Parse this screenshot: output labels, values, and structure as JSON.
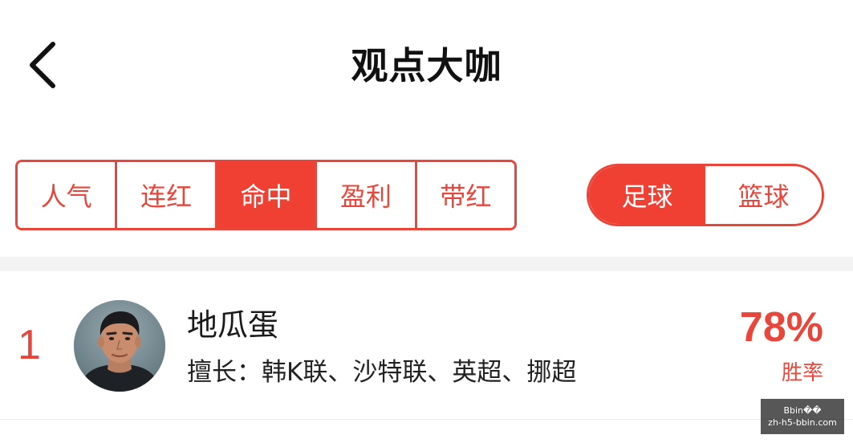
{
  "header": {
    "title": "观点大咖",
    "back_icon": "chevron-left-icon"
  },
  "rank_tabs": [
    {
      "label": "人气",
      "active": false
    },
    {
      "label": "连红",
      "active": false
    },
    {
      "label": "命中",
      "active": true
    },
    {
      "label": "盈利",
      "active": false
    },
    {
      "label": "带红",
      "active": false
    }
  ],
  "sport_toggle": [
    {
      "label": "足球",
      "active": true
    },
    {
      "label": "篮球",
      "active": false
    }
  ],
  "experts": [
    {
      "rank": "1",
      "name": "地瓜蛋",
      "specialty": "擅长：韩K联、沙特联、英超、挪超",
      "win_rate": "78%",
      "win_rate_label": "胜率"
    }
  ],
  "watermark": {
    "line1": "Bbin��",
    "line2": "zh-h5-bbin.com"
  },
  "colors": {
    "accent": "#e8463a",
    "accent_fill": "#ef4033",
    "divider": "#f3f3f3"
  }
}
